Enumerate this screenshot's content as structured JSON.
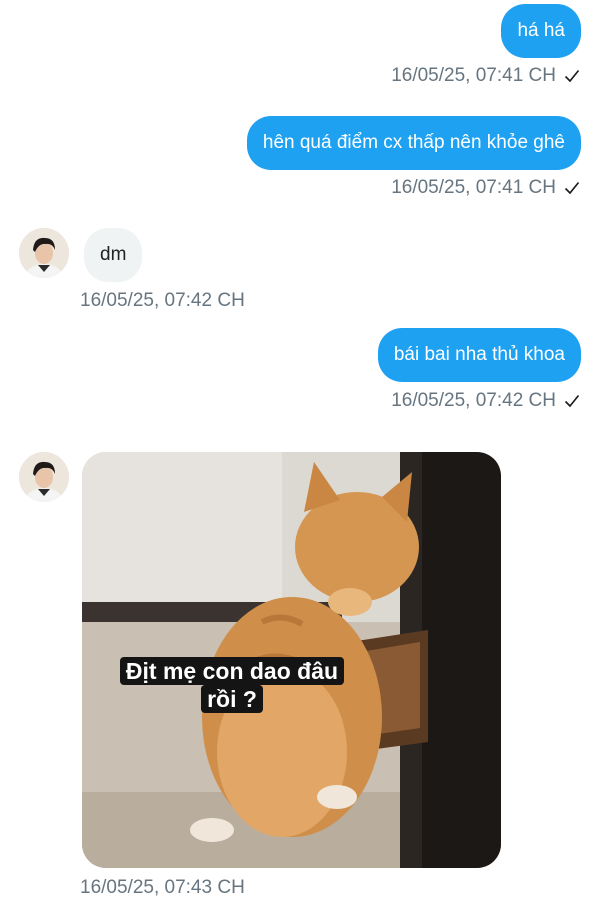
{
  "messages": [
    {
      "text": "há há",
      "time": "16/05/25, 07:41 CH"
    },
    {
      "text": "hên quá điểm cx thấp nên khỏe ghê",
      "time": "16/05/25, 07:41 CH"
    },
    {
      "text": "dm",
      "time": "16/05/25, 07:42 CH"
    },
    {
      "text": "bái bai nha thủ khoa",
      "time": "16/05/25, 07:42 CH"
    },
    {
      "time": "16/05/25, 07:43 CH",
      "image_caption_line1": "Địt mẹ con dao đâu",
      "image_caption_line2": "rồi ?"
    }
  ],
  "icons": {
    "read_status": "check-icon",
    "contact": "avatar"
  },
  "colors": {
    "outgoing_bubble": "#1fa1f2",
    "incoming_bubble": "#eff3f4",
    "timestamp": "#66757f"
  }
}
